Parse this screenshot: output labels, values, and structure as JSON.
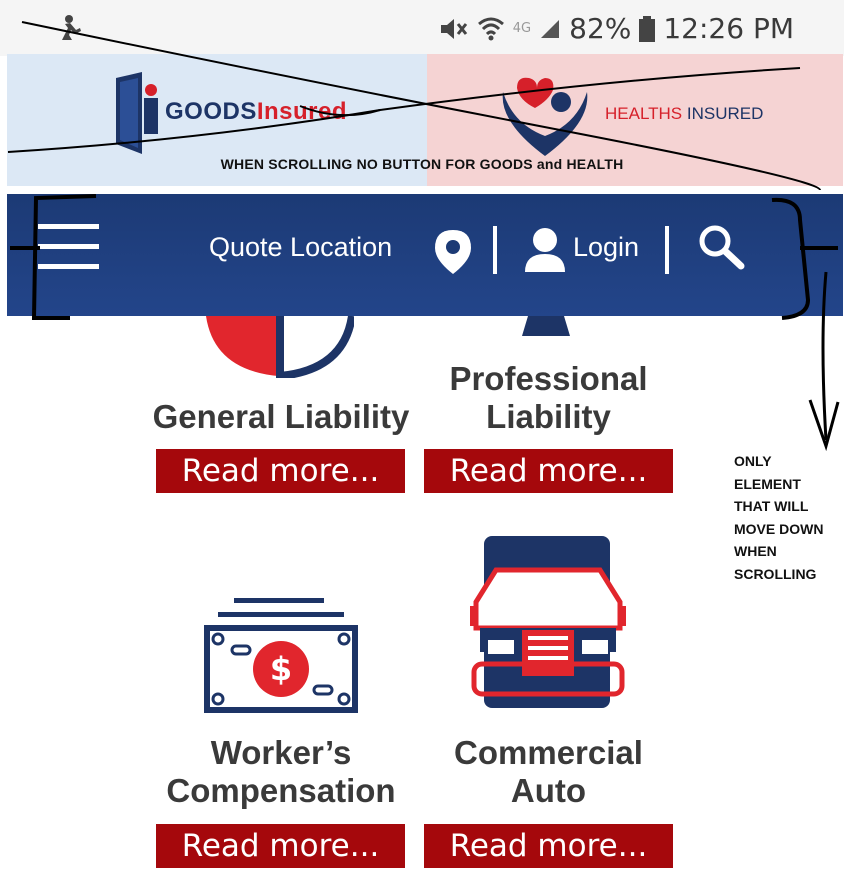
{
  "status_bar": {
    "battery": "82%",
    "time": "12:26 PM",
    "network": "4G"
  },
  "brand": {
    "goods_part1": "GOODS",
    "goods_part2": "Insured",
    "health_part1": "HEALTHS",
    "health_part2": " INSURED"
  },
  "annotations": {
    "banner_note": "WHEN SCROLLING NO BUTTON FOR GOODS and HEALTH",
    "side_note": [
      "ONLY",
      "ELEMENT",
      "THAT WILL",
      "MOVE DOWN",
      "WHEN",
      "SCROLLING"
    ]
  },
  "nav": {
    "quote_location": "Quote Location",
    "login": "Login"
  },
  "cards": [
    {
      "title_lines": [
        "General Liability"
      ],
      "read_more": "Read more...",
      "icon": "shield-icon"
    },
    {
      "title_lines": [
        "Professional",
        "Liability"
      ],
      "read_more": "Read more...",
      "icon": "briefcase-icon"
    },
    {
      "title_lines": [
        "Worker’s",
        "Compensation"
      ],
      "read_more": "Read more...",
      "icon": "money-bill-icon"
    },
    {
      "title_lines": [
        "Commercial",
        "Auto"
      ],
      "read_more": "Read more...",
      "icon": "truck-icon"
    }
  ],
  "colors": {
    "navy": "#1d3466",
    "nav_bar": "#1c3a75",
    "red_button": "#a5080c",
    "brand_red": "#d6202a",
    "goods_bg": "#dce8f5",
    "health_bg": "#f5d3d3"
  }
}
